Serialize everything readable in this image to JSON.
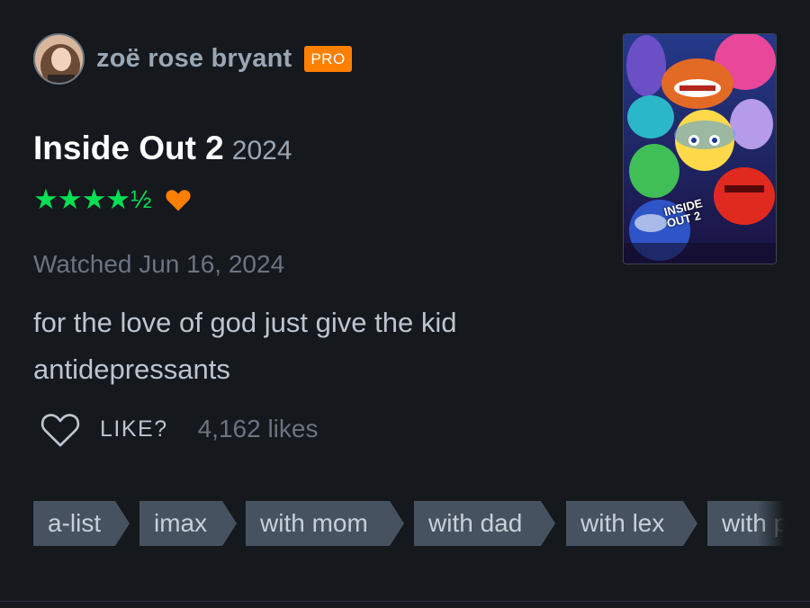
{
  "user": {
    "name": "zoë rose bryant",
    "badge": "PRO"
  },
  "film": {
    "title": "Inside Out 2",
    "year": "2024",
    "poster_title": "INSIDE\nOUT 2"
  },
  "rating": {
    "stars": "★★★★",
    "half": "½",
    "value": 4.5,
    "liked": true
  },
  "watched": "Watched Jun 16, 2024",
  "review": "for the love of god just give the kid antidepressants",
  "likes": {
    "label": "LIKE?",
    "count": "4,162 likes"
  },
  "tags": [
    "a-list",
    "imax",
    "with mom",
    "with dad",
    "with lex",
    "with pr"
  ],
  "colors": {
    "accent_green": "#00e054",
    "accent_orange": "#ff8000",
    "background": "#15181d"
  }
}
